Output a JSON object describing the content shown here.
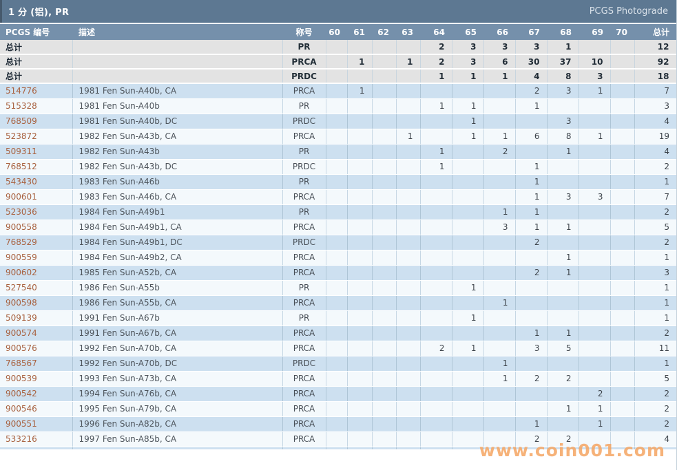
{
  "title_bar": {
    "title": "1 分 (铝), PR",
    "right_link": "PCGS Photograde"
  },
  "table": {
    "headers": {
      "pcgs_no": "PCGS 编号",
      "description": "描述",
      "designation": "称号",
      "grades": [
        "60",
        "61",
        "62",
        "63",
        "64",
        "65",
        "66",
        "67",
        "68",
        "69",
        "70"
      ],
      "total": "总计"
    },
    "totals_label": "总计",
    "totals_rows": [
      {
        "designation": "PR",
        "grades": {
          "64": "2",
          "65": "3",
          "66": "3",
          "67": "3",
          "68": "1"
        },
        "total": "12"
      },
      {
        "designation": "PRCA",
        "grades": {
          "61": "1",
          "63": "1",
          "64": "2",
          "65": "3",
          "66": "6",
          "67": "30",
          "68": "37",
          "69": "10"
        },
        "total": "92"
      },
      {
        "designation": "PRDC",
        "grades": {
          "64": "1",
          "65": "1",
          "66": "1",
          "67": "4",
          "68": "8",
          "69": "3"
        },
        "total": "18"
      }
    ],
    "rows": [
      {
        "num": "514776",
        "desc": "1981 Fen Sun-A40b, CA",
        "designation": "PRCA",
        "grades": {
          "61": "1",
          "67": "2",
          "68": "3",
          "69": "1"
        },
        "total": "7"
      },
      {
        "num": "515328",
        "desc": "1981 Fen Sun-A40b",
        "designation": "PR",
        "grades": {
          "64": "1",
          "65": "1",
          "67": "1"
        },
        "total": "3"
      },
      {
        "num": "768509",
        "desc": "1981 Fen Sun-A40b, DC",
        "designation": "PRDC",
        "grades": {
          "65": "1",
          "68": "3"
        },
        "total": "4"
      },
      {
        "num": "523872",
        "desc": "1982 Fen Sun-A43b, CA",
        "designation": "PRCA",
        "grades": {
          "63": "1",
          "65": "1",
          "66": "1",
          "67": "6",
          "68": "8",
          "69": "1"
        },
        "total": "19"
      },
      {
        "num": "509311",
        "desc": "1982 Fen Sun-A43b",
        "designation": "PR",
        "grades": {
          "64": "1",
          "66": "2",
          "68": "1"
        },
        "total": "4"
      },
      {
        "num": "768512",
        "desc": "1982 Fen Sun-A43b, DC",
        "designation": "PRDC",
        "grades": {
          "64": "1",
          "67": "1"
        },
        "total": "2"
      },
      {
        "num": "543430",
        "desc": "1983 Fen Sun-A46b",
        "designation": "PR",
        "grades": {
          "67": "1"
        },
        "total": "1"
      },
      {
        "num": "900601",
        "desc": "1983 Fen Sun-A46b, CA",
        "designation": "PRCA",
        "grades": {
          "67": "1",
          "68": "3",
          "69": "3"
        },
        "total": "7"
      },
      {
        "num": "523036",
        "desc": "1984 Fen Sun-A49b1",
        "designation": "PR",
        "grades": {
          "66": "1",
          "67": "1"
        },
        "total": "2"
      },
      {
        "num": "900558",
        "desc": "1984 Fen Sun-A49b1, CA",
        "designation": "PRCA",
        "grades": {
          "66": "3",
          "67": "1",
          "68": "1"
        },
        "total": "5"
      },
      {
        "num": "768529",
        "desc": "1984 Fen Sun-A49b1, DC",
        "designation": "PRDC",
        "grades": {
          "67": "2"
        },
        "total": "2"
      },
      {
        "num": "900559",
        "desc": "1984 Fen Sun-A49b2, CA",
        "designation": "PRCA",
        "grades": {
          "68": "1"
        },
        "total": "1"
      },
      {
        "num": "900602",
        "desc": "1985 Fen Sun-A52b, CA",
        "designation": "PRCA",
        "grades": {
          "67": "2",
          "68": "1"
        },
        "total": "3"
      },
      {
        "num": "527540",
        "desc": "1986 Fen Sun-A55b",
        "designation": "PR",
        "grades": {
          "65": "1"
        },
        "total": "1"
      },
      {
        "num": "900598",
        "desc": "1986 Fen Sun-A55b, CA",
        "designation": "PRCA",
        "grades": {
          "66": "1"
        },
        "total": "1"
      },
      {
        "num": "509139",
        "desc": "1991 Fen Sun-A67b",
        "designation": "PR",
        "grades": {
          "65": "1"
        },
        "total": "1"
      },
      {
        "num": "900574",
        "desc": "1991 Fen Sun-A67b, CA",
        "designation": "PRCA",
        "grades": {
          "67": "1",
          "68": "1"
        },
        "total": "2"
      },
      {
        "num": "900576",
        "desc": "1992 Fen Sun-A70b, CA",
        "designation": "PRCA",
        "grades": {
          "64": "2",
          "65": "1",
          "67": "3",
          "68": "5"
        },
        "total": "11"
      },
      {
        "num": "768567",
        "desc": "1992 Fen Sun-A70b, DC",
        "designation": "PRDC",
        "grades": {
          "66": "1"
        },
        "total": "1"
      },
      {
        "num": "900539",
        "desc": "1993 Fen Sun-A73b, CA",
        "designation": "PRCA",
        "grades": {
          "66": "1",
          "67": "2",
          "68": "2"
        },
        "total": "5"
      },
      {
        "num": "900542",
        "desc": "1994 Fen Sun-A76b, CA",
        "designation": "PRCA",
        "grades": {
          "69": "2"
        },
        "total": "2"
      },
      {
        "num": "900546",
        "desc": "1995 Fen Sun-A79b, CA",
        "designation": "PRCA",
        "grades": {
          "68": "1",
          "69": "1"
        },
        "total": "2"
      },
      {
        "num": "900551",
        "desc": "1996 Fen Sun-A82b, CA",
        "designation": "PRCA",
        "grades": {
          "67": "1",
          "69": "1"
        },
        "total": "2"
      },
      {
        "num": "533216",
        "desc": "1997 Fen Sun-A85b, CA",
        "designation": "PRCA",
        "grades": {
          "67": "2",
          "68": "2"
        },
        "total": "4"
      }
    ]
  },
  "watermark": "www.coin001.com",
  "colors": {
    "title_bg": "#5d7892",
    "header_bg": "#7590ab",
    "totals_bg": "#e3e3e3",
    "row_blue": "#cde0f0",
    "row_light": "#f4f9fc",
    "pcgs_link": "#a8613f",
    "watermark": "#f4a461"
  }
}
